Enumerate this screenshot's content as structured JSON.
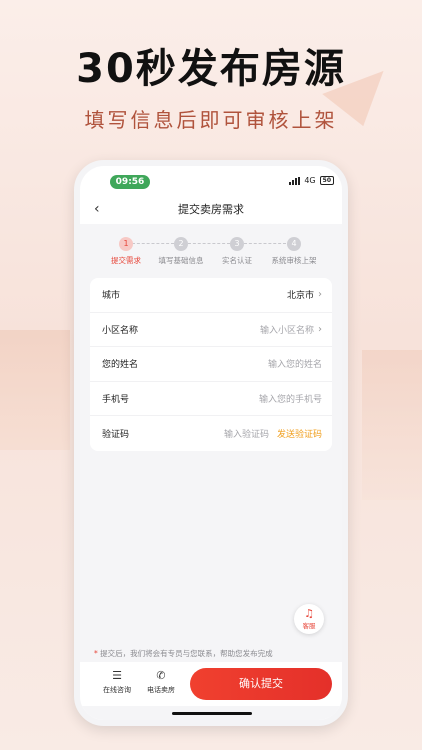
{
  "promo": {
    "title": "30秒发布房源",
    "subtitle": "填写信息后即可审核上架"
  },
  "status": {
    "time": "09:56",
    "network": "4G",
    "battery": "50"
  },
  "nav": {
    "back_icon": "chevron-left-icon",
    "title": "提交卖房需求"
  },
  "steps": [
    {
      "num": "1",
      "label": "提交需求"
    },
    {
      "num": "2",
      "label": "填写基础信息"
    },
    {
      "num": "3",
      "label": "实名认证"
    },
    {
      "num": "4",
      "label": "系统审核上架"
    }
  ],
  "form": {
    "city_label": "城市",
    "city_value": "北京市",
    "community_label": "小区名称",
    "community_placeholder": "输入小区名称",
    "name_label": "您的姓名",
    "name_placeholder": "输入您的姓名",
    "phone_label": "手机号",
    "phone_placeholder": "输入您的手机号",
    "code_label": "验证码",
    "code_placeholder": "输入验证码",
    "send_code": "发送验证码"
  },
  "customer_service": {
    "icon": "headset-icon",
    "label": "客服"
  },
  "notice": {
    "star": "*",
    "text": "提交后，我们将会有专员与您联系，帮助您发布完成"
  },
  "bottom": {
    "online_label": "在线咨询",
    "phone_label": "电话卖房",
    "confirm_label": "确认提交"
  },
  "colors": {
    "accent": "#e7463a",
    "orange": "#f0a020",
    "status_green": "#3fa75a"
  }
}
